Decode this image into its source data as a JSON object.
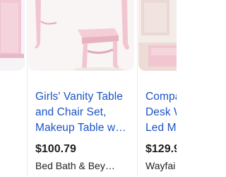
{
  "results": {
    "items": [
      {
        "title_lines": [
          "Girls' Vanity Table",
          "and Chair Set,",
          "Makeup Table w…"
        ],
        "price": "$100.79",
        "seller": "Bed Bath & Bey…",
        "image_icon": "pink-vanity-stool-image"
      },
      {
        "title_lines": [
          "Compa",
          "Desk W",
          "Led Mi"
        ],
        "price": "$129.9",
        "seller": "Wayfai",
        "image_icon": "pink-desk-room-image"
      }
    ]
  },
  "colors": {
    "link_blue": "#1a53c6",
    "furniture_pink": "#f2c6d0",
    "furniture_pink_shadow": "#e2a9b7",
    "price_text": "#1d1d1d"
  }
}
